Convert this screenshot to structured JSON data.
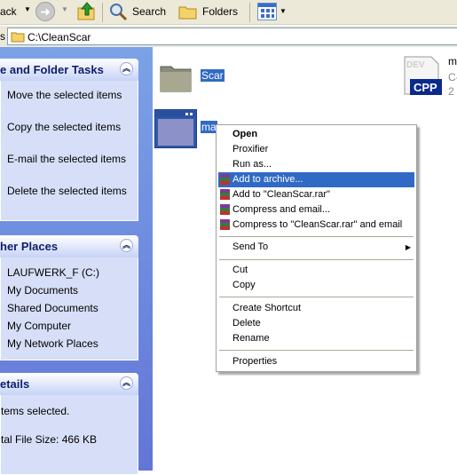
{
  "toolbar": {
    "back_label": "ack",
    "search_label": "Search",
    "folders_label": "Folders"
  },
  "address": {
    "path": "C:\\CleanScar",
    "label_fragment": "s"
  },
  "left_pane": {
    "file_tasks": {
      "title": "e and Folder Tasks",
      "items": [
        "Move the selected items",
        "Copy the selected items",
        "E-mail the selected items",
        "Delete the selected items"
      ]
    },
    "other_places": {
      "title": "her Places",
      "items": [
        "LAUFWERK_F (C:)",
        "My Documents",
        "Shared Documents",
        "My Computer",
        "My Network Places"
      ]
    },
    "details": {
      "title": "etails",
      "selected_text": "tems selected.",
      "size_text": "tal File Size: 466 KB"
    }
  },
  "files": {
    "scar_folder": "Scar",
    "selected_label": "ma",
    "cpp_file": {
      "name": "m",
      "line2": "C-",
      "line3": "2",
      "badge": "CPP",
      "ghost": "DEV"
    }
  },
  "context_menu": {
    "items": [
      {
        "label": "Open",
        "bold": true
      },
      {
        "label": "Proxifier"
      },
      {
        "label": "Run as..."
      },
      {
        "label": "Add to archive...",
        "highlight": true,
        "icon": "winrar-icon"
      },
      {
        "label": "Add to \"CleanScar.rar\"",
        "icon": "winrar-icon"
      },
      {
        "label": "Compress and email...",
        "icon": "winrar-icon"
      },
      {
        "label": "Compress to \"CleanScar.rar\" and email",
        "icon": "winrar-icon"
      },
      {
        "label": "Send To",
        "submenu": true
      },
      {
        "label": "Cut"
      },
      {
        "label": "Copy"
      },
      {
        "label": "Create Shortcut"
      },
      {
        "label": "Delete"
      },
      {
        "label": "Rename"
      },
      {
        "label": "Properties"
      }
    ]
  },
  "colors": {
    "menu_highlight": "#316ac5",
    "taskpane_gradient": "#6375d6",
    "panel_body": "#d6dff7"
  }
}
